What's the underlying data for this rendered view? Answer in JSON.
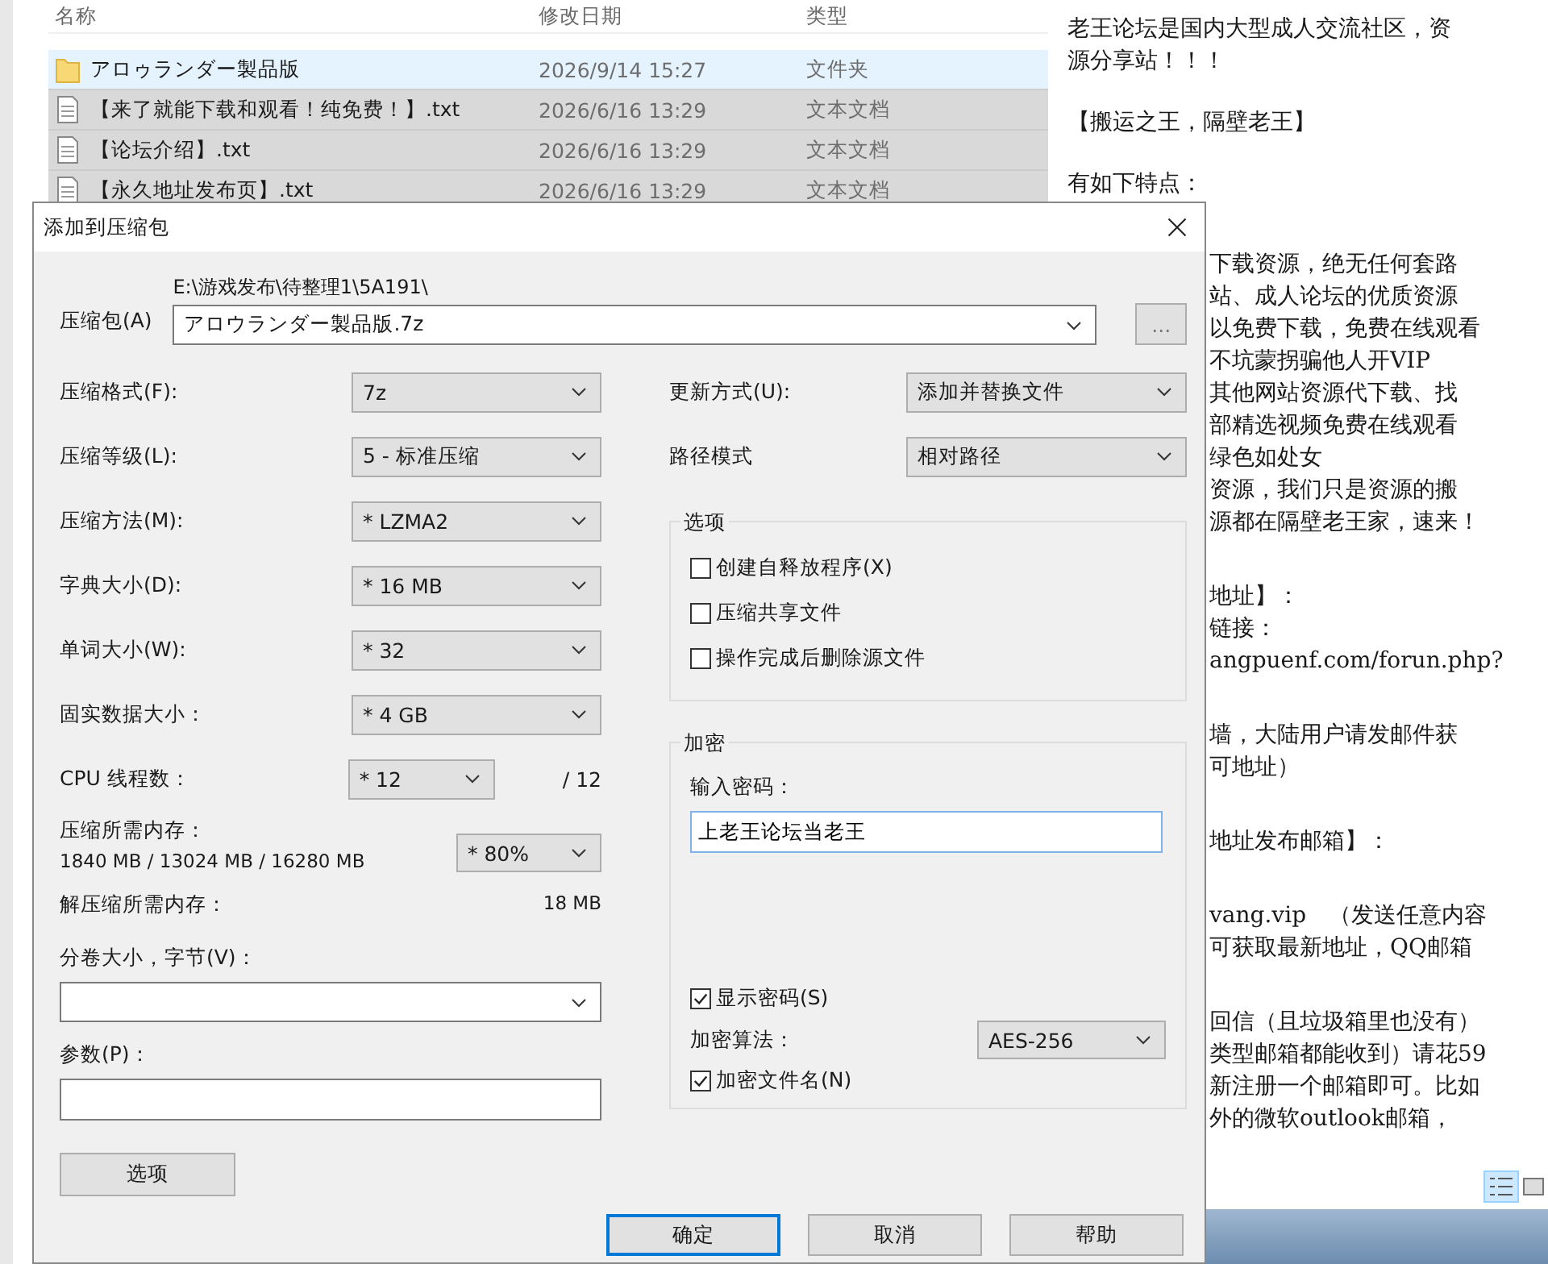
{
  "explorer": {
    "columns": [
      "名称",
      "修改日期",
      "类型"
    ],
    "rows": [
      {
        "kind": "folder",
        "name": "アロゥランダー製品版",
        "modified": "2026/9/14 15:27",
        "type": "文件夹",
        "selected": false,
        "hovered": true
      },
      {
        "kind": "file",
        "name": "【来了就能下载和观看！纯免费！】.txt",
        "modified": "2026/6/16 13:29",
        "type": "文本文档",
        "selected": true,
        "hovered": false
      },
      {
        "kind": "file",
        "name": "【论坛介绍】.txt",
        "modified": "2026/6/16 13:29",
        "type": "文本文档",
        "selected": true,
        "hovered": false
      },
      {
        "kind": "file",
        "name": "【永久地址发布页】.txt",
        "modified": "2026/6/16 13:29",
        "type": "文本文档",
        "selected": true,
        "hovered": false
      }
    ]
  },
  "text_pane": {
    "paragraphs": [
      [
        "老王论坛是国内大型成人交流社区，资",
        "源分享站！！！"
      ],
      [
        "【搬运之王，隔壁老王】"
      ],
      [
        "有如下特点："
      ]
    ],
    "partial_paragraphs": [
      [
        "下载资源，绝无任何套路",
        "站、成人论坛的优质资源",
        "以免费下载，免费在线观看",
        "不坑蒙拐骗他人开VIP",
        " 其他网站资源代下载、找",
        "部精选视频免费在线观看",
        "绿色如处女",
        "资源，我们只是资源的搬",
        "源都在隔壁老王家，速来！"
      ],
      [
        "地址】：",
        "链接：",
        "angpuenf.com/forun.php?"
      ],
      [
        "墙，大陆用户请发邮件获",
        "可地址）"
      ],
      [
        "地址发布邮箱】："
      ],
      [
        "vang.vip　（发送任意内容",
        "可获取最新地址，QQ邮箱"
      ],
      [
        "回信（且垃圾箱里也没有）",
        "类型邮箱都能收到）请花59",
        "新注册一个邮箱即可。比如",
        "外的微软outlook邮箱，"
      ]
    ]
  },
  "dialog": {
    "title": "添加到压缩包",
    "archive": {
      "label": "压缩包(A)",
      "folder": "E:\\游戏发布\\待整理1\\5A191\\",
      "value": "アロウランダー製品版.7z",
      "browse": "..."
    },
    "left_rows": [
      {
        "label": "压缩格式(F):",
        "value": "7z"
      },
      {
        "label": "压缩等级(L):",
        "value": "5 - 标准压缩"
      },
      {
        "label": "压缩方法(M):",
        "value": "* LZMA2"
      },
      {
        "label": "字典大小(D):",
        "value": "* 16 MB"
      },
      {
        "label": "单词大小(W):",
        "value": "* 32"
      },
      {
        "label": "固实数据大小：",
        "value": "* 4 GB"
      },
      {
        "label": "CPU 线程数：",
        "value": "* 12",
        "suffix": "/ 12"
      }
    ],
    "memory": {
      "label": "压缩所需内存：",
      "detail": "1840 MB / 13024 MB / 16280 MB",
      "value": "* 80%"
    },
    "decompress": {
      "label": "解压缩所需内存：",
      "value": "18 MB"
    },
    "volume": {
      "label": "分卷大小，字节(V)："
    },
    "params": {
      "label": "参数(P)："
    },
    "options_button": "选项",
    "right_rows": [
      {
        "label": "更新方式(U):",
        "value": "添加并替换文件"
      },
      {
        "label": "路径模式",
        "value": "相对路径"
      }
    ],
    "options": {
      "title": "选项",
      "checkboxes": [
        {
          "label": "创建自释放程序(X)",
          "checked": false
        },
        {
          "label": "压缩共享文件",
          "checked": false
        },
        {
          "label": "操作完成后删除源文件",
          "checked": false
        }
      ]
    },
    "encryption": {
      "title": "加密",
      "password_label": "输入密码：",
      "password": "上老王论坛当老王",
      "show_password": {
        "label": "显示密码(S)",
        "checked": true
      },
      "method_label": "加密算法：",
      "method": "AES-256",
      "encrypt_names": {
        "label": "加密文件名(N)",
        "checked": true
      }
    },
    "buttons": [
      {
        "label": "确定",
        "default": true
      },
      {
        "label": "取消",
        "default": false
      },
      {
        "label": "帮助",
        "default": false
      }
    ]
  }
}
